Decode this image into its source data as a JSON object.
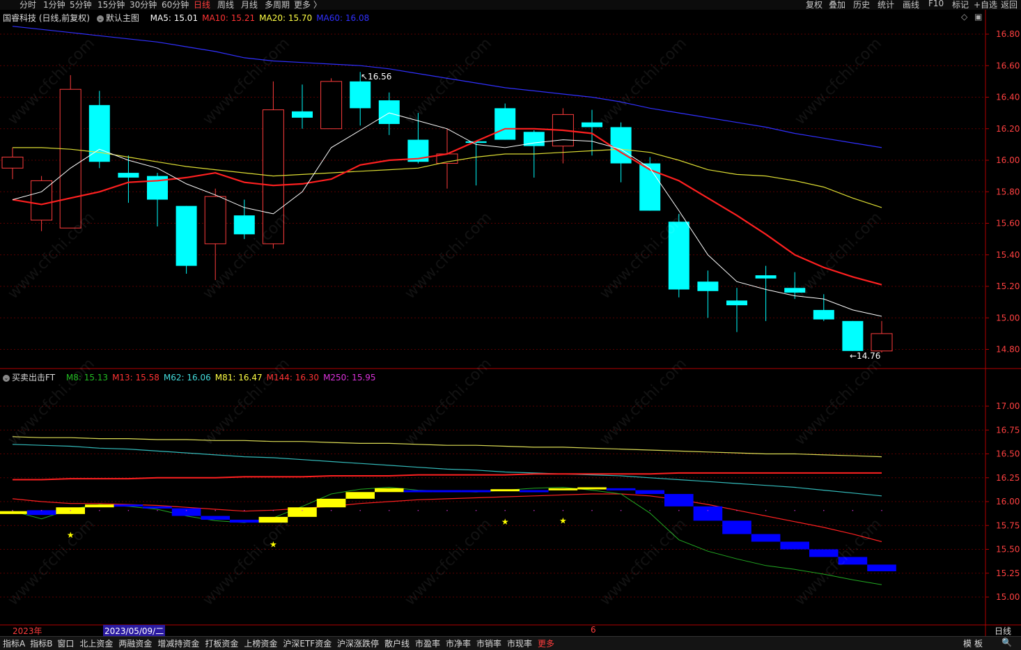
{
  "toolbar": {
    "periods": [
      "分时",
      "1分钟",
      "5分钟",
      "15分钟",
      "30分钟",
      "60分钟",
      "日线",
      "周线",
      "月线",
      "多周期",
      "更多 〉"
    ],
    "active_period": "日线",
    "right": [
      "复权",
      "叠加",
      "历史",
      "统计",
      "画线",
      "F10",
      "标记",
      "+自选",
      "返回"
    ]
  },
  "main_panel": {
    "stock": "国睿科技 (日线,前复权)",
    "template": "默认主图",
    "ma": [
      {
        "label": "MA5: 15.01",
        "color": "#ffffff"
      },
      {
        "label": "MA10: 15.21",
        "color": "#ff3333"
      },
      {
        "label": "MA20: 15.70",
        "color": "#ffff44"
      },
      {
        "label": "MA60: 16.08",
        "color": "#3030ff"
      }
    ],
    "high_mark": "16.56",
    "low_mark": "14.76",
    "price_ticks": [
      "16.80",
      "16.60",
      "16.40",
      "16.20",
      "16.00",
      "15.80",
      "15.60",
      "15.40",
      "15.20",
      "15.00",
      "14.80"
    ]
  },
  "sub_panel": {
    "name": "买卖出击FT",
    "lines": [
      {
        "label": "M8: 15.13",
        "color": "#22bb22"
      },
      {
        "label": "M13: 15.58",
        "color": "#ff3333"
      },
      {
        "label": "M62: 16.06",
        "color": "#44dddd"
      },
      {
        "label": "M81: 16.47",
        "color": "#ffff44"
      },
      {
        "label": "M144: 16.30",
        "color": "#ff3333"
      },
      {
        "label": "M250: 15.95",
        "color": "#dd33dd"
      }
    ],
    "ticks": [
      "17.00",
      "16.75",
      "16.50",
      "16.25",
      "16.00",
      "15.75",
      "15.50",
      "15.25",
      "15.00"
    ]
  },
  "date_axis": {
    "year": "2023年",
    "cursor_date": "2023/05/09/二",
    "month_mark": "6",
    "period_label": "日线"
  },
  "bottom_tabs": [
    "指标A",
    "指标B",
    "窗口",
    "北上资金",
    "两融资金",
    "增减持资金",
    "打板资金",
    "上榜资金",
    "沪深ETF资金",
    "沪深涨跌停",
    "散户线",
    "市盈率",
    "市净率",
    "市销率",
    "市现率",
    "更多"
  ],
  "bottom_right": [
    "模",
    "板",
    "🔍"
  ],
  "watermark": "www.cfchi.com",
  "chart_data": {
    "type": "candlestick",
    "candles": [
      {
        "o": 15.95,
        "c": 16.02,
        "h": 16.08,
        "l": 15.88
      },
      {
        "o": 15.62,
        "c": 15.87,
        "h": 15.9,
        "l": 15.55
      },
      {
        "o": 15.57,
        "c": 16.45,
        "h": 16.54,
        "l": 15.57
      },
      {
        "o": 16.35,
        "c": 15.99,
        "h": 16.44,
        "l": 15.95
      },
      {
        "o": 15.92,
        "c": 15.89,
        "h": 16.03,
        "l": 15.73
      },
      {
        "o": 15.9,
        "c": 15.75,
        "h": 15.92,
        "l": 15.58
      },
      {
        "o": 15.71,
        "c": 15.33,
        "h": 15.71,
        "l": 15.28
      },
      {
        "o": 15.47,
        "c": 15.77,
        "h": 15.82,
        "l": 15.24
      },
      {
        "o": 15.65,
        "c": 15.53,
        "h": 15.75,
        "l": 15.5
      },
      {
        "o": 15.47,
        "c": 16.32,
        "h": 16.5,
        "l": 15.44
      },
      {
        "o": 16.31,
        "c": 16.27,
        "h": 16.48,
        "l": 16.2
      },
      {
        "o": 16.2,
        "c": 16.5,
        "h": 16.52,
        "l": 16.2
      },
      {
        "o": 16.5,
        "c": 16.33,
        "h": 16.56,
        "l": 16.22
      },
      {
        "o": 16.38,
        "c": 16.23,
        "h": 16.43,
        "l": 16.16
      },
      {
        "o": 16.13,
        "c": 15.99,
        "h": 16.3,
        "l": 15.98
      },
      {
        "o": 15.98,
        "c": 16.04,
        "h": 16.2,
        "l": 15.82
      },
      {
        "o": 16.12,
        "c": 16.11,
        "h": 16.12,
        "l": 15.84
      },
      {
        "o": 16.33,
        "c": 16.13,
        "h": 16.36,
        "l": 16.13
      },
      {
        "o": 16.18,
        "c": 16.09,
        "h": 16.19,
        "l": 15.89
      },
      {
        "o": 16.09,
        "c": 16.29,
        "h": 16.33,
        "l": 15.98
      },
      {
        "o": 16.24,
        "c": 16.21,
        "h": 16.32,
        "l": 16.03
      },
      {
        "o": 16.21,
        "c": 15.98,
        "h": 16.24,
        "l": 15.86
      },
      {
        "o": 15.98,
        "c": 15.68,
        "h": 16.02,
        "l": 15.68
      },
      {
        "o": 15.61,
        "c": 15.18,
        "h": 15.66,
        "l": 15.13
      },
      {
        "o": 15.23,
        "c": 15.17,
        "h": 15.3,
        "l": 15.0
      },
      {
        "o": 15.11,
        "c": 15.08,
        "h": 15.19,
        "l": 14.91
      },
      {
        "o": 15.27,
        "c": 15.25,
        "h": 15.33,
        "l": 14.98
      },
      {
        "o": 15.19,
        "c": 15.16,
        "h": 15.29,
        "l": 15.12
      },
      {
        "o": 15.05,
        "c": 14.99,
        "h": 15.15,
        "l": 14.98
      },
      {
        "o": 14.98,
        "c": 14.79,
        "h": 14.98,
        "l": 14.79
      },
      {
        "o": 14.79,
        "c": 14.9,
        "h": 14.98,
        "l": 14.78
      }
    ],
    "ma5": [
      15.75,
      15.8,
      15.95,
      16.07,
      16.0,
      15.95,
      15.85,
      15.78,
      15.7,
      15.66,
      15.8,
      16.08,
      16.19,
      16.3,
      16.25,
      16.2,
      16.1,
      16.08,
      16.11,
      16.13,
      16.12,
      16.07,
      15.95,
      15.68,
      15.4,
      15.23,
      15.18,
      15.14,
      15.12,
      15.05,
      15.01
    ],
    "ma10": [
      15.75,
      15.72,
      15.76,
      15.8,
      15.86,
      15.87,
      15.89,
      15.92,
      15.86,
      15.84,
      15.85,
      15.88,
      15.97,
      16.0,
      16.01,
      16.04,
      16.12,
      16.2,
      16.2,
      16.19,
      16.17,
      16.05,
      15.94,
      15.87,
      15.76,
      15.65,
      15.53,
      15.4,
      15.32,
      15.26,
      15.21
    ],
    "ma20": [
      16.08,
      16.08,
      16.07,
      16.05,
      16.02,
      15.99,
      15.96,
      15.94,
      15.92,
      15.9,
      15.91,
      15.92,
      15.93,
      15.94,
      15.95,
      15.99,
      16.02,
      16.04,
      16.04,
      16.05,
      16.06,
      16.07,
      16.05,
      16.0,
      15.94,
      15.91,
      15.9,
      15.87,
      15.83,
      15.76,
      15.7
    ],
    "ma60": [
      16.85,
      16.83,
      16.81,
      16.79,
      16.77,
      16.75,
      16.72,
      16.69,
      16.65,
      16.63,
      16.62,
      16.61,
      16.6,
      16.58,
      16.55,
      16.52,
      16.49,
      16.46,
      16.44,
      16.42,
      16.4,
      16.37,
      16.33,
      16.3,
      16.27,
      16.24,
      16.21,
      16.17,
      16.14,
      16.11,
      16.08
    ],
    "sub_ylim": [
      14.85,
      17.15
    ],
    "m8": [
      15.9,
      15.82,
      15.92,
      15.97,
      15.95,
      15.92,
      15.85,
      15.8,
      15.78,
      15.83,
      15.95,
      16.08,
      16.13,
      16.15,
      16.12,
      16.11,
      16.1,
      16.12,
      16.14,
      16.15,
      16.12,
      16.08,
      15.88,
      15.6,
      15.48,
      15.4,
      15.33,
      15.29,
      15.24,
      15.18,
      15.13
    ],
    "m13": [
      16.03,
      16.0,
      15.98,
      15.98,
      15.97,
      15.96,
      15.94,
      15.92,
      15.9,
      15.91,
      15.93,
      15.95,
      15.98,
      16.0,
      16.02,
      16.03,
      16.04,
      16.05,
      16.06,
      16.07,
      16.08,
      16.08,
      16.06,
      16.02,
      15.97,
      15.91,
      15.85,
      15.79,
      15.73,
      15.66,
      15.58
    ],
    "m62": [
      16.6,
      16.59,
      16.58,
      16.56,
      16.55,
      16.53,
      16.51,
      16.49,
      16.47,
      16.46,
      16.44,
      16.42,
      16.4,
      16.38,
      16.36,
      16.34,
      16.33,
      16.31,
      16.3,
      16.29,
      16.28,
      16.27,
      16.25,
      16.23,
      16.21,
      16.19,
      16.17,
      16.15,
      16.12,
      16.09,
      16.06
    ],
    "m81": [
      16.68,
      16.67,
      16.67,
      16.66,
      16.66,
      16.65,
      16.65,
      16.64,
      16.64,
      16.63,
      16.63,
      16.62,
      16.61,
      16.61,
      16.6,
      16.59,
      16.59,
      16.58,
      16.57,
      16.57,
      16.56,
      16.55,
      16.54,
      16.53,
      16.52,
      16.51,
      16.5,
      16.5,
      16.49,
      16.48,
      16.47
    ],
    "m144": [
      16.23,
      16.23,
      16.24,
      16.24,
      16.24,
      16.25,
      16.25,
      16.25,
      16.26,
      16.26,
      16.26,
      16.27,
      16.27,
      16.27,
      16.28,
      16.28,
      16.28,
      16.28,
      16.29,
      16.29,
      16.29,
      16.29,
      16.29,
      16.3,
      16.3,
      16.3,
      16.3,
      16.3,
      16.3,
      16.3,
      16.3
    ],
    "ft_blocks": [
      {
        "a": 15.87,
        "b": 15.9,
        "up": true
      },
      {
        "a": 15.86,
        "b": 15.91,
        "up": false
      },
      {
        "a": 15.87,
        "b": 15.94,
        "up": true
      },
      {
        "a": 15.94,
        "b": 15.97,
        "up": true
      },
      {
        "a": 15.95,
        "b": 15.97,
        "up": false
      },
      {
        "a": 15.93,
        "b": 15.95,
        "up": false
      },
      {
        "a": 15.85,
        "b": 15.93,
        "up": false
      },
      {
        "a": 15.81,
        "b": 15.85,
        "up": false
      },
      {
        "a": 15.78,
        "b": 15.81,
        "up": false
      },
      {
        "a": 15.78,
        "b": 15.84,
        "up": true
      },
      {
        "a": 15.84,
        "b": 15.94,
        "up": true
      },
      {
        "a": 15.94,
        "b": 16.03,
        "up": true
      },
      {
        "a": 16.03,
        "b": 16.1,
        "up": true
      },
      {
        "a": 16.1,
        "b": 16.14,
        "up": true
      },
      {
        "a": 16.11,
        "b": 16.12,
        "up": false
      },
      {
        "a": 16.11,
        "b": 16.12,
        "up": false
      },
      {
        "a": 16.1,
        "b": 16.12,
        "up": false
      },
      {
        "a": 16.11,
        "b": 16.13,
        "up": true
      },
      {
        "a": 16.11,
        "b": 16.12,
        "up": false
      },
      {
        "a": 16.12,
        "b": 16.14,
        "up": true
      },
      {
        "a": 16.13,
        "b": 16.15,
        "up": true
      },
      {
        "a": 16.12,
        "b": 16.14,
        "up": false
      },
      {
        "a": 16.08,
        "b": 16.12,
        "up": false
      },
      {
        "a": 15.95,
        "b": 16.08,
        "up": false
      },
      {
        "a": 15.8,
        "b": 15.95,
        "up": false
      },
      {
        "a": 15.66,
        "b": 15.8,
        "up": false
      },
      {
        "a": 15.58,
        "b": 15.66,
        "up": false
      },
      {
        "a": 15.5,
        "b": 15.58,
        "up": false
      },
      {
        "a": 15.42,
        "b": 15.5,
        "up": false
      },
      {
        "a": 15.34,
        "b": 15.42,
        "up": false
      },
      {
        "a": 15.27,
        "b": 15.34,
        "up": false
      }
    ],
    "stars": [
      {
        "i": 2,
        "v": 15.65
      },
      {
        "i": 9,
        "v": 15.55
      },
      {
        "i": 17,
        "v": 15.79
      },
      {
        "i": 19,
        "v": 15.8
      }
    ],
    "colors": {
      "up": "#ff3c3c",
      "down": "#00ffff",
      "ft_up": "#ffff00",
      "ft_down": "#0000ff"
    }
  }
}
